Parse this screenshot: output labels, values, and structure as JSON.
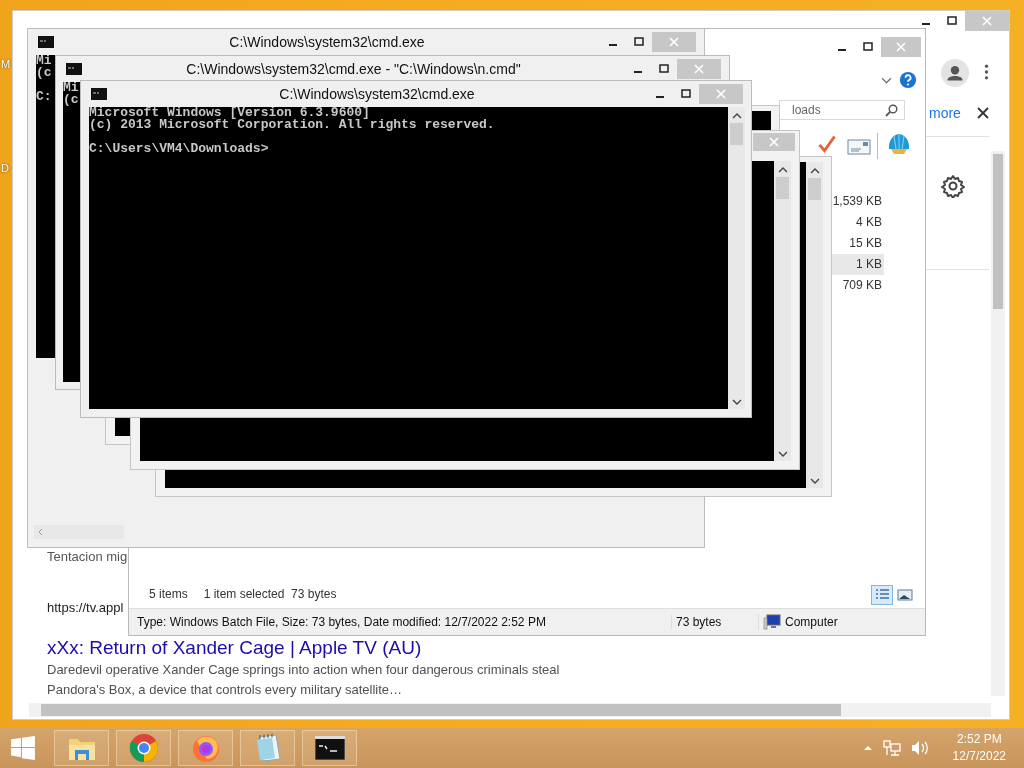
{
  "desktop": {
    "icon_labels": [
      "M",
      "D"
    ]
  },
  "browser": {
    "more_link": "more",
    "snippets": [
      {
        "kind": "title",
        "text": "Tentacion mig"
      },
      {
        "kind": "url",
        "text": "https://tv.appl"
      },
      {
        "kind": "link",
        "text": "xXx: Return of Xander Cage | Apple TV (AU)"
      },
      {
        "kind": "description",
        "text": "Daredevil operative Xander Cage springs into action when four dangerous criminals steal Pandora's Box, a device that controls every military satellite…"
      }
    ]
  },
  "explorer": {
    "search": {
      "value": "loads"
    },
    "sizes": [
      {
        "text": "1,539 KB",
        "selected": false
      },
      {
        "text": "4 KB",
        "selected": false
      },
      {
        "text": "15 KB",
        "selected": false
      },
      {
        "text": "1 KB",
        "selected": true
      },
      {
        "text": "709 KB",
        "selected": false
      }
    ],
    "item_count": "5 items",
    "selection": "1 item selected  73 bytes",
    "status_bar": {
      "details": "Type: Windows Batch File, Size: 73 bytes, Date modified: 12/7/2022 2:52 PM",
      "size": "73 bytes",
      "zone": "Computer"
    }
  },
  "consoles": [
    {
      "title": "C:\\Windows\\system32\\cmd.exe",
      "blocks": [
        [
          "Mi",
          "(c"
        ],
        [
          "C:"
        ]
      ]
    },
    {
      "title": "C:\\Windows\\system32\\cmd.exe - \"C:\\Windows\\n.cmd\"",
      "blocks": [
        [
          "Mi",
          "(c"
        ]
      ]
    },
    {
      "title": "C:\\Windows\\system32\\cmd.exe",
      "blocks": [
        [
          "Microsoft Windows [Version 6.3.9600]",
          "(c) 2013 Microsoft Corporation. All rights reserved."
        ],
        [
          "C:\\Users\\VM4\\Downloads>"
        ]
      ]
    }
  ],
  "taskbar": {
    "apps": [
      {
        "kind": "explorer"
      },
      {
        "kind": "chrome"
      },
      {
        "kind": "firefox"
      },
      {
        "kind": "notepad"
      },
      {
        "kind": "cmd"
      }
    ],
    "time": "2:52 PM",
    "date": "12/7/2022"
  }
}
